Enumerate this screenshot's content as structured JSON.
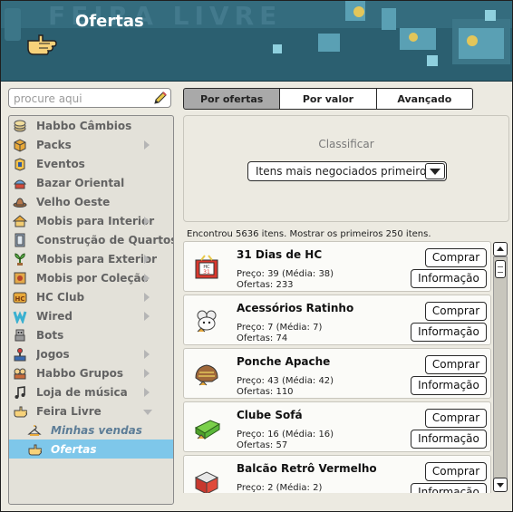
{
  "header": {
    "title": "Ofertas",
    "icon": "hand-point-icon"
  },
  "search": {
    "placeholder": "procure aqui",
    "value": ""
  },
  "sidebar": {
    "items": [
      {
        "label": "Habbo Câmbios",
        "icon": "coins-icon",
        "arrow": false
      },
      {
        "label": "Packs",
        "icon": "box-icon",
        "arrow": true
      },
      {
        "label": "Eventos",
        "icon": "event-icon",
        "arrow": false
      },
      {
        "label": "Bazar Oriental",
        "icon": "oriental-icon",
        "arrow": false
      },
      {
        "label": "Velho Oeste",
        "icon": "cowboy-hat-icon",
        "arrow": false
      },
      {
        "label": "Mobis para Interior",
        "icon": "house-icon",
        "arrow": true
      },
      {
        "label": "Construção de Quartos",
        "icon": "door-icon",
        "arrow": false
      },
      {
        "label": "Mobis para Exterior",
        "icon": "plant-icon",
        "arrow": true
      },
      {
        "label": "Mobis por Coleção",
        "icon": "collection-icon",
        "arrow": true
      },
      {
        "label": "HC Club",
        "icon": "hc-icon",
        "arrow": true
      },
      {
        "label": "Wired",
        "icon": "wired-icon",
        "arrow": true
      },
      {
        "label": "Bots",
        "icon": "bot-icon",
        "arrow": false
      },
      {
        "label": "Jogos",
        "icon": "joystick-icon",
        "arrow": true
      },
      {
        "label": "Habbo Grupos",
        "icon": "groups-icon",
        "arrow": true
      },
      {
        "label": "Loja de música",
        "icon": "music-note-icon",
        "arrow": true
      },
      {
        "label": "Feira Livre",
        "icon": "hand-icon",
        "arrow": "down"
      }
    ],
    "sub_items": [
      {
        "label": "Minhas vendas",
        "icon": "hanger-icon",
        "selected": false
      },
      {
        "label": "Ofertas",
        "icon": "hand-point-icon",
        "selected": true
      }
    ]
  },
  "tabs": [
    {
      "label": "Por ofertas",
      "active": true
    },
    {
      "label": "Por valor",
      "active": false
    },
    {
      "label": "Avançado",
      "active": false
    }
  ],
  "sort": {
    "label": "Classificar",
    "selected": "Itens mais negociados primeiro"
  },
  "found_text": "Encontrou 5636 itens. Mostrar os primeiros 250 itens.",
  "buttons": {
    "buy": "Comprar",
    "info": "Informação"
  },
  "results": [
    {
      "name": "31 Dias de HC",
      "price": "Preço: 39 (Média: 38)",
      "offers": "Ofertas: 233",
      "icon": "hc-calendar-icon"
    },
    {
      "name": "Acessórios Ratinho",
      "price": "Preço: 7 (Média: 7)",
      "offers": "Ofertas: 74",
      "icon": "mouse-accessory-icon"
    },
    {
      "name": "Ponche Apache",
      "price": "Preço: 43 (Média: 42)",
      "offers": "Ofertas: 110",
      "icon": "poncho-icon"
    },
    {
      "name": "Clube Sofá",
      "price": "Preço: 16 (Média: 16)",
      "offers": "Ofertas: 57",
      "icon": "sofa-icon"
    },
    {
      "name": "Balcão Retrô Vermelho",
      "price": "Preço: 2 (Média: 2)",
      "offers": "",
      "icon": "counter-icon"
    }
  ],
  "colors": {
    "header_bg": "#2b5f70",
    "selected_bg": "#7ec7ea",
    "sub_item_text": "#5d7d97"
  }
}
